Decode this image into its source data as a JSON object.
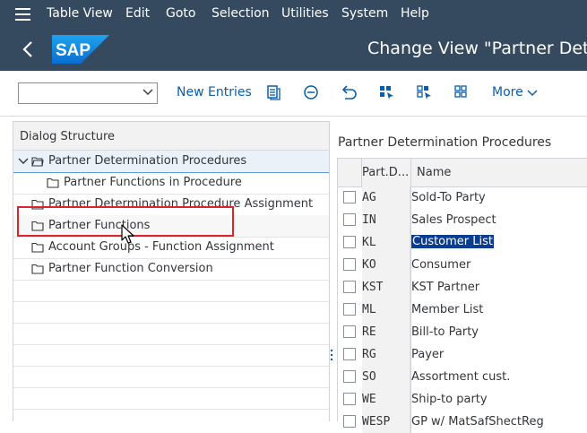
{
  "menubar": {
    "items": [
      "Table View",
      "Edit",
      "Goto",
      "Selection",
      "Utilities",
      "System",
      "Help"
    ]
  },
  "shell": {
    "logo_text": "SAP",
    "title": "Change View \"Partner Dete"
  },
  "toolbar": {
    "combo_value": "",
    "new_entries": "New Entries",
    "more": "More"
  },
  "dialog": {
    "header": "Dialog Structure",
    "items": [
      "Partner Determination Procedures",
      "Partner Functions in Procedure",
      "Partner Determination Procedure Assignment",
      "Partner Functions",
      "Account Groups - Function Assignment",
      "Partner Function Conversion"
    ]
  },
  "table": {
    "title": "Partner Determination Procedures",
    "columns": [
      "Part.D...",
      "Name"
    ],
    "rows": [
      {
        "code": "AG",
        "name": "Sold-To Party"
      },
      {
        "code": "IN",
        "name": "Sales Prospect"
      },
      {
        "code": "KL",
        "name": "Customer List"
      },
      {
        "code": "KO",
        "name": "Consumer"
      },
      {
        "code": "KST",
        "name": "KST Partner"
      },
      {
        "code": "ML",
        "name": "Member List"
      },
      {
        "code": "RE",
        "name": "Bill-to Party"
      },
      {
        "code": "RG",
        "name": "Payer"
      },
      {
        "code": "SO",
        "name": "Assortment cust."
      },
      {
        "code": "WE",
        "name": "Ship-to party"
      },
      {
        "code": "WESP",
        "name": "GP w/ MatSafShectReg"
      }
    ]
  },
  "colors": {
    "shell_bg": "#354a5f",
    "link_blue": "#0a5ea8",
    "highlight_red": "#d9262b",
    "selection_blue": "#0a3d8f"
  }
}
